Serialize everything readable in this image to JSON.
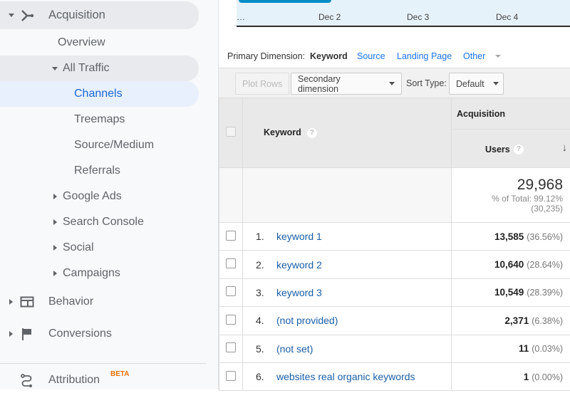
{
  "sidebar": {
    "acquisition": "Acquisition",
    "overview": "Overview",
    "all_traffic": "All Traffic",
    "channels": "Channels",
    "treemaps": "Treemaps",
    "source_medium": "Source/Medium",
    "referrals": "Referrals",
    "google_ads": "Google Ads",
    "search_console": "Search Console",
    "social": "Social",
    "campaigns": "Campaigns",
    "behavior": "Behavior",
    "conversions": "Conversions",
    "attribution": "Attribution",
    "beta": "BETA"
  },
  "chart": {
    "ticks": [
      "…",
      "Dec 2",
      "Dec 3",
      "Dec 4"
    ]
  },
  "primary_dimension": {
    "label": "Primary Dimension:",
    "active": "Keyword",
    "options": [
      "Source",
      "Landing Page",
      "Other"
    ]
  },
  "toolbar": {
    "plot_rows": "Plot Rows",
    "secondary_dimension": "Secondary dimension",
    "sort_type_label": "Sort Type:",
    "sort_type": "Default"
  },
  "table": {
    "group_header": "Acquisition",
    "keyword_header": "Keyword",
    "users_header": "Users",
    "help": "?",
    "total": {
      "value": "29,968",
      "pct": "% of Total: 99.12%",
      "of": "(30,235)"
    },
    "rows": [
      {
        "index": "1.",
        "keyword": "keyword 1",
        "users": "13,585",
        "pct": "(36.56%)"
      },
      {
        "index": "2.",
        "keyword": "keyword 2",
        "users": "10,640",
        "pct": "(28.64%)"
      },
      {
        "index": "3.",
        "keyword": "keyword 3",
        "users": "10,549",
        "pct": "(28.39%)"
      },
      {
        "index": "4.",
        "keyword": "(not provided)",
        "users": "2,371",
        "pct": "(6.38%)"
      },
      {
        "index": "5.",
        "keyword": "(not set)",
        "users": "11",
        "pct": "(0.03%)"
      },
      {
        "index": "6.",
        "keyword": "websites real organic keywords",
        "users": "1",
        "pct": "(0.00%)"
      }
    ]
  }
}
